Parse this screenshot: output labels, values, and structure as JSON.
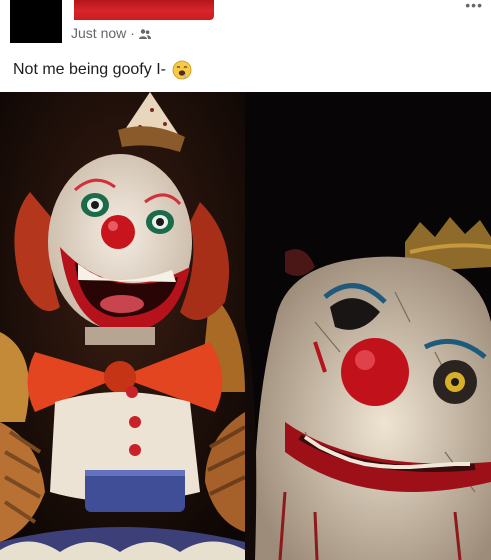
{
  "post": {
    "timestamp": "Just now",
    "separator": "·",
    "audience_icon": "friends-icon",
    "more_icon": "more-options-icon",
    "more_glyph": "•••",
    "caption": "Not me being goofy I-",
    "caption_emoji": "drooling-face-emoji",
    "media_left": "clown-animatronic-photo",
    "media_right": "scary-clown-photo"
  },
  "colors": {
    "redaction": "#d8262a",
    "meta_text": "#65676b",
    "text": "#1c1e21"
  }
}
